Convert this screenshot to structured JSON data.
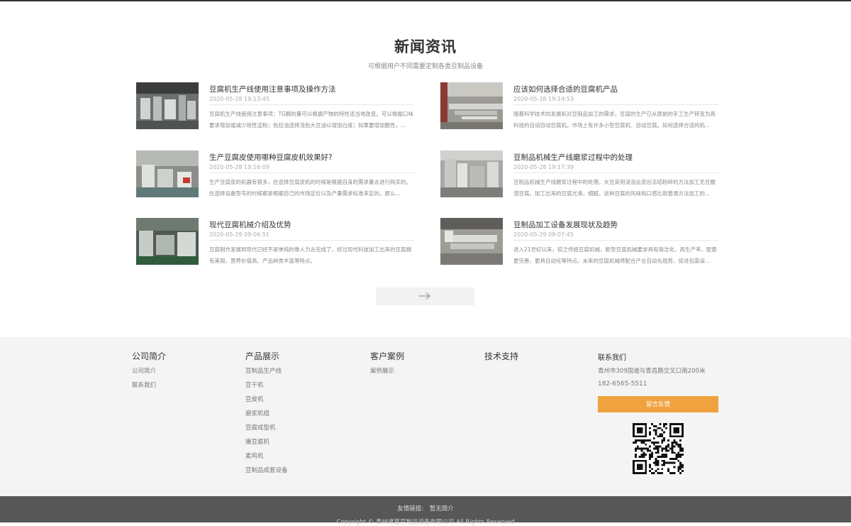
{
  "news": {
    "title": "新闻资讯",
    "subtitle": "可根据用户不同需要定制各类豆制品设备",
    "items": [
      {
        "title": "豆腐机生产线使用注意事项及操作方法",
        "date": "2020-05-28 19:13:45",
        "desc": "豆腐机生产线使用注意事项：TG酶的量可以根据产物的特性适当地改变。可以根据口味要求增加或减少玫性淀粉；色拉油选择浅色大豆油以增加白度；如果要增加脆性，..."
      },
      {
        "title": "应该如何选择合适的豆腐机产品",
        "date": "2020-05-28 19:14:53",
        "desc": "随着科学技术的发展和对豆制品加工的需求，豆腐的生产已从原始的手工生产转变为高科技的自动自动豆腐机。市场上有许多小型豆腐机、自动豆腐。如何选择合适的机..."
      },
      {
        "title": "生产豆腐皮使用哪种豆腐皮机效果好?",
        "date": "2020-05-28 19:16:09",
        "desc": "生产豆腐皮的机器有很多，在选择豆腐皮机的时候是根据自身的需求量去进行购买的。在选择设备型号的时候都是根据自己的市场定位以及产量需求标准来定的，那么..."
      },
      {
        "title": "豆制品机械生产线磨浆过程中的处理",
        "date": "2020-05-28 19:17:39",
        "desc": "豆制品机械生产线磨浆过程中的处理。大豆采用浸泡去皮后冻结粉碎的方法加工无豆腥渣豆腐。加工出来的豆腐光滑，细腻。这种豆腐的风味和口感比用普通方法加工的..."
      },
      {
        "title": "现代豆腐机械介绍及优势",
        "date": "2020-05-29 09:06:51",
        "desc": "豆腐制作发展到现代已经不是单纯的靠人力去完成了，经过现代科技加工出来的豆腐拥有美观、营养价值高、产品种类丰富等特点。"
      },
      {
        "title": "豆制品加工设备发展现状及趋势",
        "date": "2020-05-29 09:07:45",
        "desc": "进入21世纪以来，较之传统豆腐机械，新型豆腐机械要求具有简洁化、高生产率、配套更完善，更具自动化等特点。未来的豆腐机械将配合产业自动化趋势，促进包装设..."
      }
    ],
    "next_icon": "arrow-right-icon"
  },
  "footer": {
    "columns": [
      {
        "heading": "公司简介",
        "links": [
          "公司简介",
          "联系我们"
        ]
      },
      {
        "heading": "产品展示",
        "links": [
          "豆制品生产线",
          "豆干机",
          "豆皮机",
          "磨浆机组",
          "豆腐成型机",
          "嫩豆腐机",
          "素鸡机",
          "豆制品成套设备"
        ]
      },
      {
        "heading": "客户案例",
        "links": [
          "案例展示"
        ]
      },
      {
        "heading": "技术支持",
        "links": []
      }
    ],
    "contact": {
      "heading": "联系我们",
      "address": "青州市309国道与青昌路交叉口南200米",
      "phone": "182-6565-5511",
      "feedback_label": "留言反馈",
      "qr_icon": "qr-code-icon"
    },
    "accent_color": "#f0a23e"
  },
  "bottom": {
    "links_label": "友情链接:",
    "links_value": "暂无简介",
    "copyright": "Copyright © 青州诸葛豆制品设备有限公司 All Rights Reserved"
  }
}
